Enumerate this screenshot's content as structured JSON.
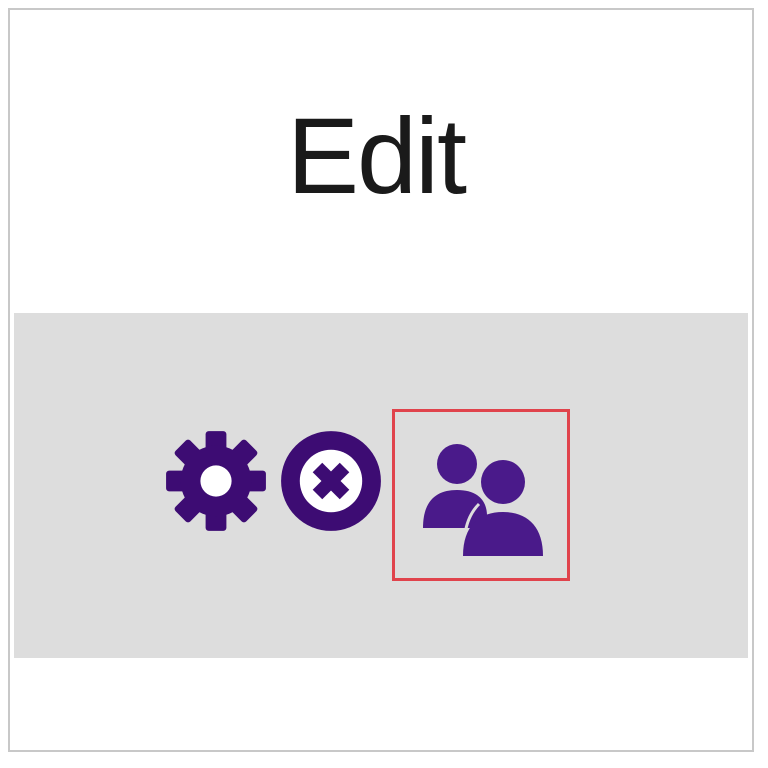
{
  "header": {
    "title": "Edit"
  },
  "actions": [
    {
      "icon": "gear-icon",
      "label": ""
    },
    {
      "icon": "circle-x-icon",
      "label": ""
    },
    {
      "icon": "users-icon",
      "label": "",
      "highlighted": true
    }
  ],
  "colors": {
    "icon_purple": "#3d0c73",
    "row_background": "#dddddd",
    "highlight_border": "#e0434c",
    "title_text": "#1a1a1a"
  }
}
